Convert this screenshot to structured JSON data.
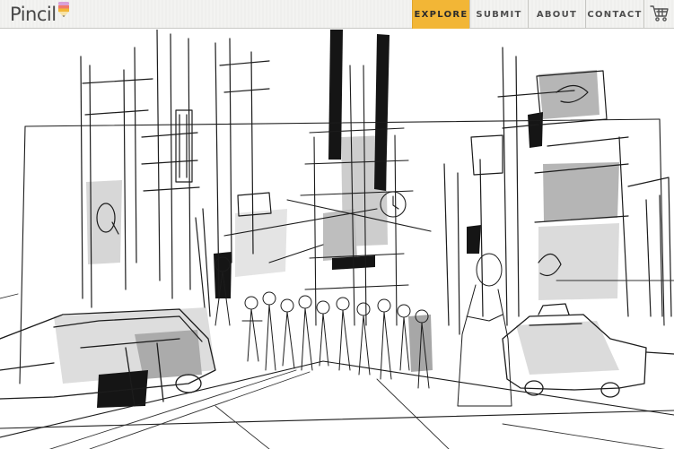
{
  "brand": {
    "name": "Pincil"
  },
  "nav": {
    "items": [
      {
        "label": "EXPLORE",
        "active": true
      },
      {
        "label": "SUBMIT",
        "active": false
      },
      {
        "label": "ABOUT",
        "active": false
      },
      {
        "label": "CONTACT",
        "active": false
      }
    ],
    "cart_icon": "shopping-cart-icon"
  },
  "colors": {
    "accent": "#f2b636",
    "header_bg": "#f3f3f1",
    "logo_stripes": [
      "#d9a0d8",
      "#f07a6a",
      "#f2b636"
    ]
  },
  "hero": {
    "image": "ink-sketch-city-street"
  }
}
